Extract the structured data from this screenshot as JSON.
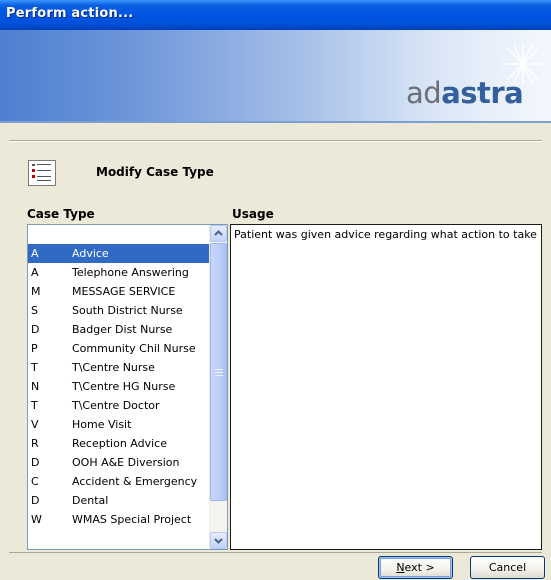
{
  "window": {
    "title": "Perform action..."
  },
  "banner": {
    "logo_regular": "ad",
    "logo_bold": "astra"
  },
  "header": {
    "title": "Modify Case Type",
    "icon": "form-checklist-icon"
  },
  "case_type": {
    "label": "Case Type",
    "rows": [
      {
        "code": "A",
        "desc": "Advice",
        "selected": true
      },
      {
        "code": "A",
        "desc": "Telephone Answering"
      },
      {
        "code": "M",
        "desc": "MESSAGE SERVICE"
      },
      {
        "code": "S",
        "desc": "South District Nurse"
      },
      {
        "code": "D",
        "desc": "Badger Dist Nurse"
      },
      {
        "code": "P",
        "desc": "Community Chil Nurse"
      },
      {
        "code": "T",
        "desc": "T\\Centre Nurse"
      },
      {
        "code": "N",
        "desc": "T\\Centre HG Nurse"
      },
      {
        "code": "T",
        "desc": "T\\Centre Doctor"
      },
      {
        "code": "V",
        "desc": "Home Visit"
      },
      {
        "code": "R",
        "desc": "Reception Advice"
      },
      {
        "code": "D",
        "desc": "OOH A&E Diversion"
      },
      {
        "code": "C",
        "desc": "Accident & Emergency"
      },
      {
        "code": "D",
        "desc": "Dental"
      },
      {
        "code": "W",
        "desc": "WMAS Special Project"
      }
    ]
  },
  "usage": {
    "label": "Usage",
    "text": "Patient was given advice regarding what action to take"
  },
  "buttons": {
    "next_mnemonic": "N",
    "next_rest": "ext >",
    "cancel": "Cancel"
  },
  "colors": {
    "selection": "#316ac5",
    "titlebar": "#0054e3"
  }
}
